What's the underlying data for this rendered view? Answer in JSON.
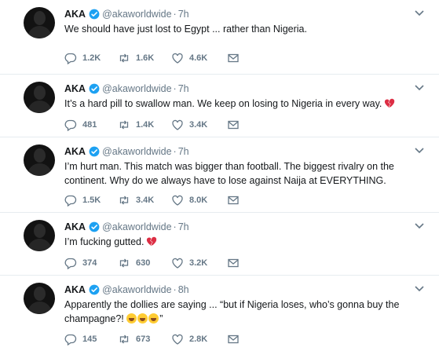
{
  "tweets": [
    {
      "name": "AKA",
      "handle": "@akaworldwide",
      "sep": "·",
      "time": "7h",
      "text": "We should have just lost to Egypt ... rather than Nigeria.",
      "replies": "1.2K",
      "retweets": "1.6K",
      "likes": "4.6K"
    },
    {
      "name": "AKA",
      "handle": "@akaworldwide",
      "sep": "·",
      "time": "7h",
      "text": "It’s a hard pill to swallow man. We keep on losing to Nigeria in every way.",
      "emoji": "broken-heart",
      "replies": "481",
      "retweets": "1.4K",
      "likes": "3.4K"
    },
    {
      "name": "AKA",
      "handle": "@akaworldwide",
      "sep": "·",
      "time": "7h",
      "text": "I’m hurt man. This match was bigger than football. The biggest rivalry on the continent. Why do we always have to lose against Naija at EVERYTHING.",
      "replies": "1.5K",
      "retweets": "3.4K",
      "likes": "8.0K"
    },
    {
      "name": "AKA",
      "handle": "@akaworldwide",
      "sep": "·",
      "time": "7h",
      "text": "I’m fucking gutted.",
      "emoji": "broken-heart",
      "replies": "374",
      "retweets": "630",
      "likes": "3.2K"
    },
    {
      "name": "AKA",
      "handle": "@akaworldwide",
      "sep": "·",
      "time": "8h",
      "text": "Apparently the dollies are saying ... “but if Nigeria loses, who’s gonna buy the champagne?!",
      "text_end": "”",
      "emoji": "laughing-tears x3",
      "replies": "145",
      "retweets": "673",
      "likes": "2.8K"
    }
  ],
  "colors": {
    "verified": "#1da1f2",
    "muted": "#657786",
    "text": "#14171a",
    "broken_heart": "#dd2e44",
    "divider": "#e6ecf0"
  },
  "icons": [
    "verified-badge-icon",
    "caret-down-icon",
    "reply-icon",
    "retweet-icon",
    "like-icon",
    "direct-message-icon",
    "broken-heart-icon",
    "laughing-emoji-icon"
  ]
}
